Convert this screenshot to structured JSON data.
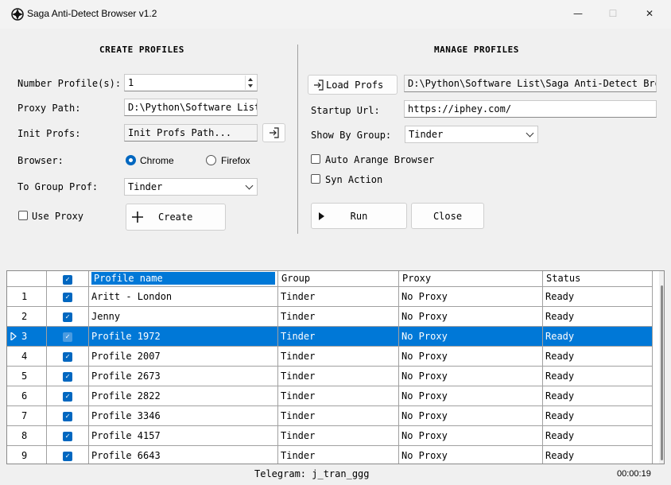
{
  "window": {
    "title": "Saga Anti-Detect Browser v1.2",
    "minimize": "—",
    "maximize": "☐",
    "close": "✕"
  },
  "create": {
    "section_title": "CREATE PROFILES",
    "number_label": "Number Profile(s):",
    "number_value": "1",
    "proxy_label": "Proxy Path:",
    "proxy_value": "D:\\Python\\Software List",
    "init_label": "Init Profs:",
    "init_value": "Init Profs Path...",
    "browser_label": "Browser:",
    "browser_chrome": "Chrome",
    "browser_firefox": "Firefox",
    "group_label": "To Group Prof:",
    "group_value": "Tinder",
    "use_proxy_label": "Use Proxy",
    "create_button": "Create"
  },
  "manage": {
    "section_title": "MANAGE PROFILES",
    "load_button": "Load Profs",
    "load_path": "D:\\Python\\Software List\\Saga Anti-Detect Brow",
    "startup_label": "Startup Url:",
    "startup_value": "https://iphey.com/",
    "show_group_label": "Show By Group:",
    "show_group_value": "Tinder",
    "auto_arrange_label": "Auto Arange Browser",
    "syn_action_label": "Syn Action",
    "run_button": "Run",
    "close_button": "Close"
  },
  "grid": {
    "columns": [
      "",
      "",
      "Profile name",
      "Group",
      "Proxy",
      "Status"
    ],
    "rows": [
      {
        "num": "1",
        "name": "Aritt - London",
        "group": "Tinder",
        "proxy": "No Proxy",
        "status": "Ready"
      },
      {
        "num": "2",
        "name": "Jenny",
        "group": "Tinder",
        "proxy": "No Proxy",
        "status": "Ready"
      },
      {
        "num": "3",
        "name": "Profile 1972",
        "group": "Tinder",
        "proxy": "No Proxy",
        "status": "Ready"
      },
      {
        "num": "4",
        "name": "Profile 2007",
        "group": "Tinder",
        "proxy": "No Proxy",
        "status": "Ready"
      },
      {
        "num": "5",
        "name": "Profile 2673",
        "group": "Tinder",
        "proxy": "No Proxy",
        "status": "Ready"
      },
      {
        "num": "6",
        "name": "Profile 2822",
        "group": "Tinder",
        "proxy": "No Proxy",
        "status": "Ready"
      },
      {
        "num": "7",
        "name": "Profile 3346",
        "group": "Tinder",
        "proxy": "No Proxy",
        "status": "Ready"
      },
      {
        "num": "8",
        "name": "Profile 4157",
        "group": "Tinder",
        "proxy": "No Proxy",
        "status": "Ready"
      },
      {
        "num": "9",
        "name": "Profile 6643",
        "group": "Tinder",
        "proxy": "No Proxy",
        "status": "Ready"
      }
    ]
  },
  "status": {
    "telegram": "Telegram: j_tran_ggg",
    "timer": "00:00:19"
  },
  "colors": {
    "accent": "#0067c0",
    "selection": "#0078d7"
  }
}
